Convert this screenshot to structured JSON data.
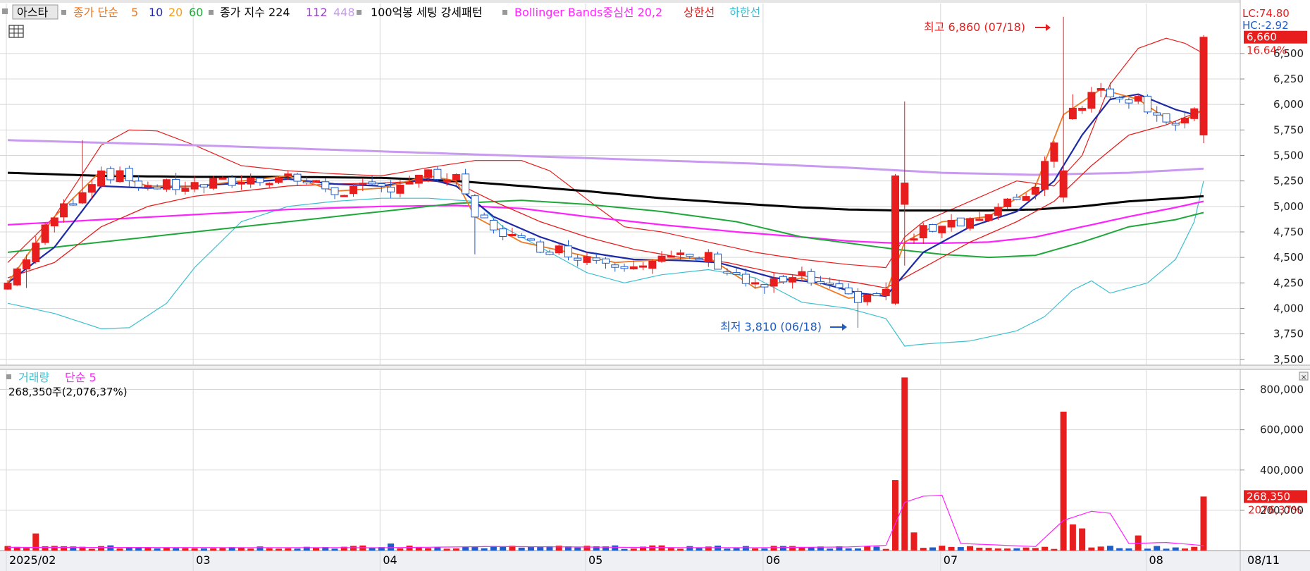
{
  "colors": {
    "up": "#e81d1d",
    "down": "#1e5cc8",
    "ma5": "#f07820",
    "ma10": "#1c2aa8",
    "ma20": "#f0a020",
    "ma60": "#1fa83a",
    "ma224": "#000000",
    "ma112": "#a040d0",
    "ma448": "#c89af0",
    "boll_mid": "#ff22ff",
    "boll_up": "#e81d1d",
    "boll_dn": "#3cc0d0",
    "grid": "#d8d8d8",
    "vol_ma": "#ff22ff"
  },
  "legend": {
    "stock_name": "아스타",
    "ma_label": "종가 단순",
    "ma_5": "5",
    "ma_10": "10",
    "ma_20": "20",
    "ma_60": "60",
    "idx_label": "종가 지수 224",
    "idx_112": "112",
    "idx_448": "448",
    "setting": "100억봉 세팅 강세패턴",
    "boll": "Bollinger Bands중심선 20,2",
    "boll_up": "상한선",
    "boll_dn": "하한선"
  },
  "right_info": {
    "lc": "LC:74.80",
    "hc": "HC:-2.92",
    "last_price": "6,660",
    "last_change": "16.64%",
    "vol_badge": "268,350",
    "vol_ratio": "2076,37%"
  },
  "volume_legend": {
    "label": "거래량",
    "ma": "단순 5",
    "value_text": "268,350주(2,076,37%)"
  },
  "annotations": {
    "high": "최고 6,860 (07/18)",
    "low": "최저 3,810 (06/18)"
  },
  "x_labels": [
    {
      "label": "2025/02",
      "idx": 0
    },
    {
      "label": "03",
      "idx": 20
    },
    {
      "label": "04",
      "idx": 40
    },
    {
      "label": "05",
      "idx": 62
    },
    {
      "label": "06",
      "idx": 81
    },
    {
      "label": "07",
      "idx": 100
    },
    {
      "label": "08",
      "idx": 122
    }
  ],
  "x_end_label": "08/11",
  "chart_data": {
    "type": "candlestick",
    "price_axis": {
      "ticks": [
        "6,500",
        "6,250",
        "6,000",
        "5,750",
        "5,500",
        "5,250",
        "5,000",
        "4,750",
        "4,500",
        "4,250",
        "4,000",
        "3,750",
        "3,500"
      ],
      "ylim": [
        3450,
        6990
      ]
    },
    "volume_axis": {
      "ticks": [
        "800,000",
        "600,000",
        "400,000",
        "200,000"
      ],
      "ylim": [
        0,
        900000
      ]
    },
    "high": {
      "value": 6860,
      "date": "07/18",
      "idx": 113
    },
    "low": {
      "value": 3810,
      "date": "06/18",
      "idx": 91
    },
    "anchors": {
      "ma5": [
        [
          0,
          4250
        ],
        [
          5,
          4900
        ],
        [
          10,
          5350
        ],
        [
          15,
          5200
        ],
        [
          20,
          5200
        ],
        [
          25,
          5250
        ],
        [
          30,
          5300
        ],
        [
          35,
          5150
        ],
        [
          40,
          5180
        ],
        [
          45,
          5300
        ],
        [
          48,
          5250
        ],
        [
          50,
          4900
        ],
        [
          55,
          4650
        ],
        [
          60,
          4550
        ],
        [
          65,
          4450
        ],
        [
          70,
          4480
        ],
        [
          75,
          4500
        ],
        [
          80,
          4200
        ],
        [
          85,
          4300
        ],
        [
          90,
          4100
        ],
        [
          94,
          4150
        ],
        [
          96,
          4650
        ],
        [
          100,
          4850
        ],
        [
          105,
          4900
        ],
        [
          110,
          5200
        ],
        [
          113,
          5900
        ],
        [
          117,
          6150
        ],
        [
          121,
          6050
        ],
        [
          125,
          5800
        ],
        [
          128,
          5950
        ]
      ],
      "ma10": [
        [
          0,
          4250
        ],
        [
          5,
          4600
        ],
        [
          10,
          5200
        ],
        [
          15,
          5180
        ],
        [
          20,
          5200
        ],
        [
          25,
          5230
        ],
        [
          30,
          5270
        ],
        [
          35,
          5220
        ],
        [
          40,
          5200
        ],
        [
          45,
          5270
        ],
        [
          48,
          5200
        ],
        [
          52,
          4900
        ],
        [
          57,
          4700
        ],
        [
          62,
          4550
        ],
        [
          67,
          4480
        ],
        [
          72,
          4470
        ],
        [
          76,
          4450
        ],
        [
          82,
          4300
        ],
        [
          87,
          4250
        ],
        [
          91,
          4150
        ],
        [
          94,
          4120
        ],
        [
          98,
          4550
        ],
        [
          103,
          4800
        ],
        [
          108,
          4950
        ],
        [
          112,
          5250
        ],
        [
          115,
          5700
        ],
        [
          118,
          6050
        ],
        [
          121,
          6100
        ],
        [
          125,
          5950
        ],
        [
          127,
          5900
        ],
        [
          128,
          5950
        ]
      ],
      "ma20": [
        [
          0,
          4300
        ],
        [
          5,
          4450
        ],
        [
          10,
          4800
        ],
        [
          15,
          5000
        ],
        [
          20,
          5100
        ],
        [
          25,
          5150
        ],
        [
          30,
          5200
        ],
        [
          35,
          5220
        ],
        [
          40,
          5230
        ],
        [
          45,
          5250
        ],
        [
          48,
          5230
        ],
        [
          52,
          5050
        ],
        [
          57,
          4850
        ],
        [
          62,
          4700
        ],
        [
          67,
          4580
        ],
        [
          72,
          4500
        ],
        [
          77,
          4450
        ],
        [
          82,
          4350
        ],
        [
          87,
          4300
        ],
        [
          91,
          4250
        ],
        [
          94,
          4200
        ],
        [
          98,
          4400
        ],
        [
          103,
          4650
        ],
        [
          108,
          4850
        ],
        [
          112,
          5050
        ],
        [
          116,
          5400
        ],
        [
          120,
          5700
        ],
        [
          124,
          5800
        ],
        [
          128,
          5950
        ]
      ],
      "ma60": [
        [
          0,
          4550
        ],
        [
          10,
          4650
        ],
        [
          20,
          4750
        ],
        [
          30,
          4850
        ],
        [
          40,
          4950
        ],
        [
          48,
          5030
        ],
        [
          55,
          5060
        ],
        [
          62,
          5020
        ],
        [
          70,
          4950
        ],
        [
          78,
          4850
        ],
        [
          85,
          4700
        ],
        [
          90,
          4640
        ],
        [
          95,
          4580
        ],
        [
          100,
          4530
        ],
        [
          105,
          4500
        ],
        [
          110,
          4520
        ],
        [
          115,
          4650
        ],
        [
          120,
          4800
        ],
        [
          125,
          4870
        ],
        [
          128,
          4940
        ]
      ],
      "ma224": [
        [
          0,
          5330
        ],
        [
          10,
          5300
        ],
        [
          20,
          5290
        ],
        [
          30,
          5290
        ],
        [
          40,
          5280
        ],
        [
          48,
          5250
        ],
        [
          55,
          5200
        ],
        [
          62,
          5150
        ],
        [
          70,
          5080
        ],
        [
          78,
          5030
        ],
        [
          85,
          4990
        ],
        [
          90,
          4970
        ],
        [
          95,
          4960
        ],
        [
          100,
          4960
        ],
        [
          105,
          4960
        ],
        [
          110,
          4970
        ],
        [
          115,
          5000
        ],
        [
          120,
          5050
        ],
        [
          125,
          5080
        ],
        [
          128,
          5100
        ]
      ],
      "ma112": [
        [
          0,
          5650
        ],
        [
          20,
          5600
        ],
        [
          40,
          5540
        ],
        [
          60,
          5480
        ],
        [
          80,
          5420
        ],
        [
          90,
          5380
        ],
        [
          100,
          5330
        ],
        [
          110,
          5310
        ],
        [
          120,
          5330
        ],
        [
          128,
          5370
        ]
      ],
      "bmid": [
        [
          0,
          4820
        ],
        [
          10,
          4870
        ],
        [
          20,
          4920
        ],
        [
          30,
          4970
        ],
        [
          40,
          5000
        ],
        [
          48,
          5010
        ],
        [
          55,
          4980
        ],
        [
          62,
          4900
        ],
        [
          70,
          4820
        ],
        [
          78,
          4750
        ],
        [
          85,
          4700
        ],
        [
          90,
          4660
        ],
        [
          95,
          4640
        ],
        [
          100,
          4640
        ],
        [
          105,
          4650
        ],
        [
          110,
          4700
        ],
        [
          115,
          4800
        ],
        [
          120,
          4900
        ],
        [
          125,
          4990
        ],
        [
          128,
          5050
        ]
      ],
      "bup": [
        [
          0,
          4450
        ],
        [
          5,
          4900
        ],
        [
          10,
          5600
        ],
        [
          13,
          5750
        ],
        [
          16,
          5740
        ],
        [
          20,
          5600
        ],
        [
          25,
          5400
        ],
        [
          30,
          5350
        ],
        [
          35,
          5320
        ],
        [
          40,
          5300
        ],
        [
          45,
          5380
        ],
        [
          50,
          5450
        ],
        [
          55,
          5450
        ],
        [
          58,
          5350
        ],
        [
          63,
          5000
        ],
        [
          66,
          4800
        ],
        [
          70,
          4750
        ],
        [
          75,
          4650
        ],
        [
          80,
          4550
        ],
        [
          85,
          4480
        ],
        [
          90,
          4430
        ],
        [
          94,
          4400
        ],
        [
          96,
          4700
        ],
        [
          98,
          4850
        ],
        [
          103,
          5050
        ],
        [
          108,
          5250
        ],
        [
          112,
          5200
        ],
        [
          115,
          5500
        ],
        [
          118,
          6200
        ],
        [
          121,
          6550
        ],
        [
          124,
          6650
        ],
        [
          126,
          6600
        ],
        [
          128,
          6500
        ]
      ],
      "bdn": [
        [
          0,
          4050
        ],
        [
          5,
          3950
        ],
        [
          10,
          3800
        ],
        [
          13,
          3810
        ],
        [
          17,
          4050
        ],
        [
          20,
          4400
        ],
        [
          25,
          4850
        ],
        [
          30,
          5000
        ],
        [
          35,
          5050
        ],
        [
          40,
          5080
        ],
        [
          45,
          5080
        ],
        [
          50,
          5050
        ],
        [
          53,
          4800
        ],
        [
          57,
          4600
        ],
        [
          62,
          4350
        ],
        [
          66,
          4250
        ],
        [
          70,
          4330
        ],
        [
          75,
          4380
        ],
        [
          80,
          4300
        ],
        [
          85,
          4060
        ],
        [
          90,
          4000
        ],
        [
          94,
          3900
        ],
        [
          96,
          3630
        ],
        [
          98,
          3650
        ],
        [
          103,
          3680
        ],
        [
          108,
          3780
        ],
        [
          111,
          3920
        ],
        [
          114,
          4180
        ],
        [
          116,
          4270
        ],
        [
          118,
          4150
        ],
        [
          122,
          4250
        ],
        [
          125,
          4480
        ],
        [
          127,
          4850
        ],
        [
          128,
          5250
        ]
      ],
      "vma": [
        [
          0,
          16000
        ],
        [
          40,
          14000
        ],
        [
          52,
          20000
        ],
        [
          60,
          18000
        ],
        [
          70,
          15000
        ],
        [
          80,
          14000
        ],
        [
          90,
          18000
        ],
        [
          94,
          26000
        ],
        [
          96,
          240000
        ],
        [
          98,
          270000
        ],
        [
          100,
          275000
        ],
        [
          102,
          35000
        ],
        [
          110,
          20000
        ],
        [
          113,
          150000
        ],
        [
          116,
          195000
        ],
        [
          118,
          185000
        ],
        [
          120,
          35000
        ],
        [
          124,
          40000
        ],
        [
          128,
          25000
        ]
      ]
    },
    "volume_spikes": [
      {
        "idx": 3,
        "value": 85000
      },
      {
        "idx": 41,
        "value": 35000
      },
      {
        "idx": 95,
        "value": 350000
      },
      {
        "idx": 96,
        "value": 860000
      },
      {
        "idx": 97,
        "value": 90000
      },
      {
        "idx": 113,
        "value": 690000
      },
      {
        "idx": 114,
        "value": 130000
      },
      {
        "idx": 115,
        "value": 110000
      },
      {
        "idx": 121,
        "value": 75000
      },
      {
        "idx": 128,
        "value": 268350
      }
    ],
    "last_bar": {
      "idx": 128,
      "close": 6660,
      "change": "16.64%",
      "volume": 268350
    }
  }
}
